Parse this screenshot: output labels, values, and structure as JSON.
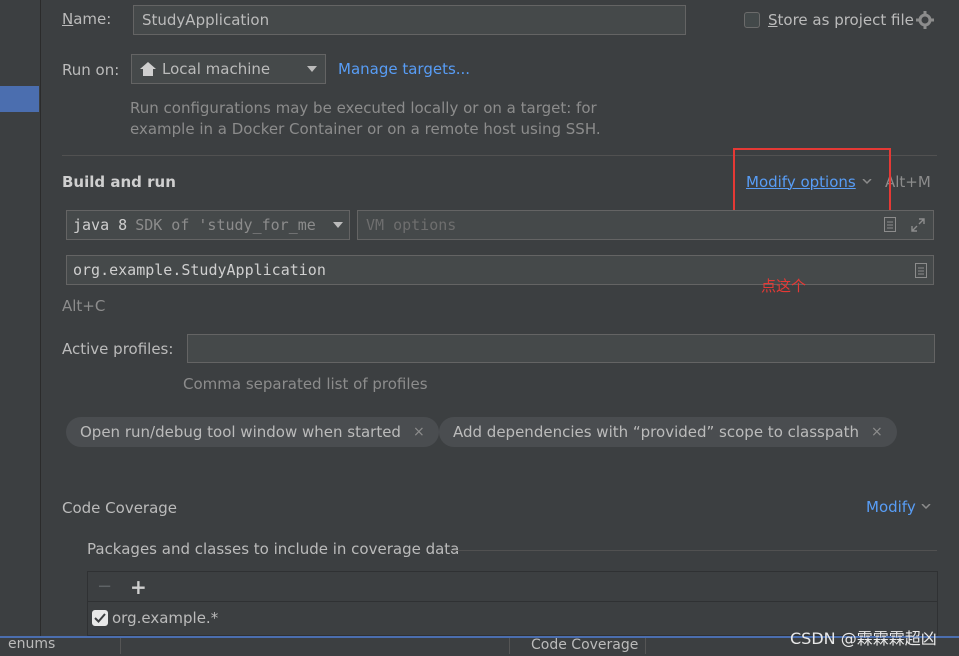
{
  "form": {
    "name_label": "Name:",
    "name_value": "StudyApplication",
    "store_label": "Store as project file",
    "run_on_label": "Run on:",
    "run_on_value": "Local machine",
    "manage_targets": "Manage targets...",
    "run_on_hint_1": "Run configurations may be executed locally or on a target: for",
    "run_on_hint_2": "example in a Docker Container or on a remote host using SSH."
  },
  "build": {
    "title": "Build and run",
    "modify_options": "Modify options",
    "shortcut": "Alt+M",
    "sdk_value_1": "java 8",
    "sdk_value_2": "SDK of 'study_for_me",
    "vm_placeholder": "VM options",
    "main_class": "org.example.StudyApplication",
    "alt_c": "Alt+C",
    "annotation": "点这个"
  },
  "profiles": {
    "label": "Active profiles:",
    "value": "",
    "hint": "Comma separated list of profiles"
  },
  "chips": [
    {
      "label": "Open run/debug tool window when started",
      "close": "×"
    },
    {
      "label": "Add dependencies with “provided” scope to classpath",
      "close": "×"
    }
  ],
  "coverage": {
    "title": "Code Coverage",
    "modify": "Modify",
    "packages_label": "Packages and classes to include in coverage data",
    "remove": "−",
    "add": "+",
    "item": "org.example.*",
    "item_checked": true
  },
  "statusbar": {
    "left": "enums",
    "center": "Code Coverage"
  },
  "watermark": "CSDN @霖霖霖超凶",
  "colors": {
    "background": "#3c3f41",
    "accent": "#589df6",
    "annotation": "#e53935",
    "selection": "#4b6eaf"
  }
}
